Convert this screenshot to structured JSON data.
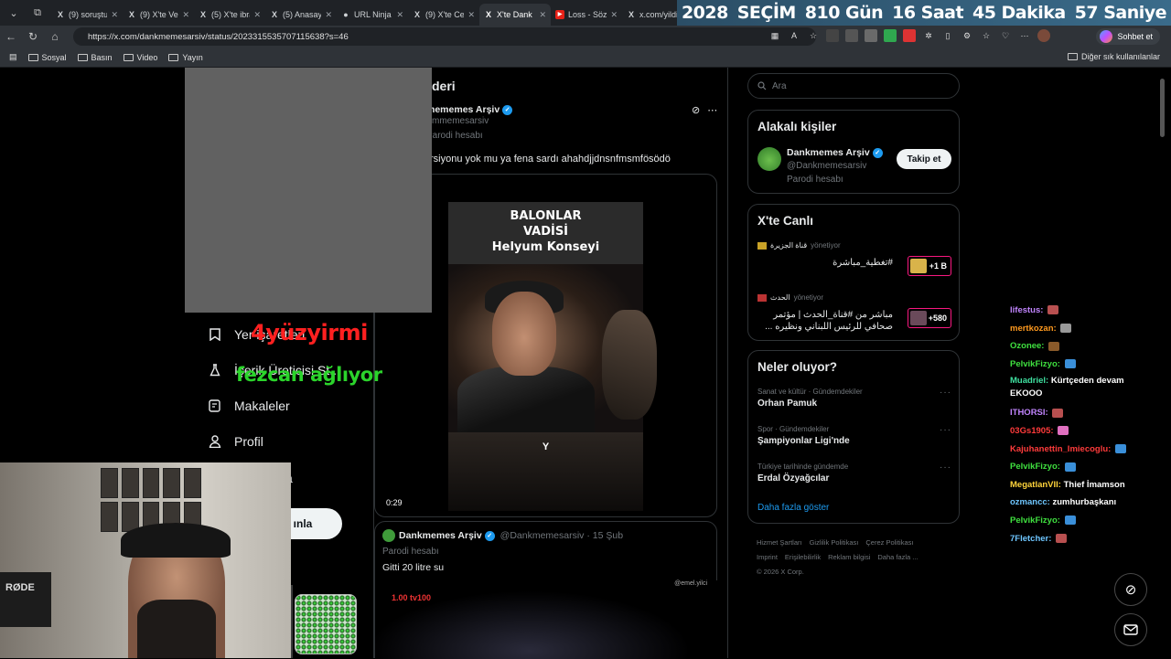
{
  "browser": {
    "tabs": [
      {
        "favicon": "X",
        "title": "(9) soruştur",
        "active": false
      },
      {
        "favicon": "X",
        "title": "(9) X'te Ver",
        "active": false
      },
      {
        "favicon": "X",
        "title": "(5) X'te ibra",
        "active": false
      },
      {
        "favicon": "X",
        "title": "(5) Anasayf",
        "active": false
      },
      {
        "favicon": "●",
        "title": "URL Ninja |",
        "active": false
      },
      {
        "favicon": "X",
        "title": "(9) X'te Ce",
        "active": false
      },
      {
        "favicon": "X",
        "title": "X'te Dank",
        "active": true
      },
      {
        "favicon": "▶",
        "title": "Loss - Söz",
        "active": false
      },
      {
        "favicon": "X",
        "title": "x.com/yildi",
        "active": false
      }
    ],
    "url": "https://x.com/dankmemesarsiv/status/2023315535707115638?s=46",
    "chat_button": "Sohbet et",
    "bookmarks": [
      "Sosyal",
      "Basın",
      "Video",
      "Yayın"
    ],
    "bookmarks_right": "Diğer sık kullanılanlar"
  },
  "countdown": {
    "year": "2028",
    "label": "SEÇİM",
    "days": "810 Gün",
    "hours": "16 Saat",
    "minutes": "45 Dakika",
    "seconds": "57 Saniye"
  },
  "leftnav": {
    "items": [
      {
        "label": "Yer işaretleri",
        "icon": "bookmark-icon"
      },
      {
        "label": "İçerik Üreticisi St...",
        "icon": "flask-icon"
      },
      {
        "label": "Makaleler",
        "icon": "article-icon"
      },
      {
        "label": "Profil",
        "icon": "person-icon"
      }
    ],
    "hidden_label": "a",
    "post_button": "ınla"
  },
  "post": {
    "header": "deri",
    "author": "mememes Arşiv",
    "handle": "mmemesarsiv",
    "parody": "Parodi hesabı",
    "text": "rsiyonu yok mu ya fena sardı ahahdjjdnsnfmsmfösödö",
    "video": {
      "caption_line1": "BALONLAR",
      "caption_line2": "VADİSİ",
      "caption_line3": "Helyum Konseyi",
      "subtitle": "Y",
      "time": "0:29"
    }
  },
  "post2": {
    "author": "Dankmemes Arşiv",
    "handle": "@Dankmemesarsiv · 15 Şub",
    "parody": "Parodi hesabı",
    "text": "Gitti 20 litre su",
    "logo": "1.00 tv100",
    "watermark": "@emel.yilci"
  },
  "sidebar": {
    "search_placeholder": "Ara",
    "related": {
      "title": "Alakalı kişiler",
      "name": "Dankmemes Arşiv",
      "handle": "@Dankmemesarsiv",
      "parody": "Parodi hesabı",
      "follow": "Takip et"
    },
    "live": {
      "title": "X'te Canlı",
      "items": [
        {
          "host": "قناة الجزيرة",
          "role": "yönetiyor",
          "title": "#تغطية_مباشرة",
          "count": "+1 B"
        },
        {
          "host": "الحدث",
          "role": "yönetiyor",
          "title": "مباشر من #قناة_الحدث | مؤتمر صحافي للرئيس اللبناني ونظيره ...",
          "count": "+580"
        }
      ]
    },
    "trends": {
      "title": "Neler oluyor?",
      "items": [
        {
          "meta": "Sanat ve kültür · Gündemdekiler",
          "name": "Orhan Pamuk"
        },
        {
          "meta": "Spor · Gündemdekiler",
          "name": "Şampiyonlar Ligi'nde"
        },
        {
          "meta": "Türkiye tarihinde gündemde",
          "name": "Erdal Özyağcılar"
        }
      ],
      "more": "Daha fazla göster"
    },
    "footer": {
      "links": [
        "Hizmet Şartları",
        "Gizlilik Politikası",
        "Çerez Politikası",
        "Imprint",
        "Erişilebilirlik",
        "Reklam bilgisi",
        "Daha fazla ..."
      ],
      "copyright": "© 2026 X Corp."
    }
  },
  "chat": [
    {
      "user": "lifestus:",
      "msg": "",
      "color": "#c084fc",
      "emote": "#b85050"
    },
    {
      "user": "mertkozan:",
      "msg": "",
      "color": "#ff9a1f",
      "emote": "#999999"
    },
    {
      "user": "Ozonee:",
      "msg": "",
      "color": "#3fe03f",
      "emote": "#8a5a2a"
    },
    {
      "user": "PelvikFizyo:",
      "msg": "",
      "color": "#3fe03f",
      "emote": "#3a8fd9"
    },
    {
      "user": "Muadriel:",
      "msg": "Kürtçeden devam EKOOO",
      "color": "#3fe0a0",
      "emote": ""
    },
    {
      "user": "ITHORSI:",
      "msg": "",
      "color": "#c084fc",
      "emote": "#b85050"
    },
    {
      "user": "03Gs1905:",
      "msg": "",
      "color": "#ff3b3b",
      "emote": "#e070c0"
    },
    {
      "user": "Kajuhanettin_Imiecoglu:",
      "msg": "",
      "color": "#ff3b3b",
      "emote": "#3a8fd9"
    },
    {
      "user": "PelvikFizyo:",
      "msg": "",
      "color": "#3fe03f",
      "emote": "#3a8fd9"
    },
    {
      "user": "MegatlanVII:",
      "msg": "Thief İmamson",
      "color": "#ffd43b",
      "emote": ""
    },
    {
      "user": "ozmancc:",
      "msg": "zumhurbaşkanı",
      "color": "#6ec6ff",
      "emote": ""
    },
    {
      "user": "PelvikFizyo:",
      "msg": "",
      "color": "#3fe03f",
      "emote": "#3a8fd9"
    },
    {
      "user": "7Fletcher:",
      "msg": "",
      "color": "#6ec6ff",
      "emote": "#b85050"
    }
  ],
  "overlays": {
    "red_text": "4yüzyirmi",
    "green_text": "fezcan ağlıyor",
    "webcam_brand": "RØDE"
  }
}
